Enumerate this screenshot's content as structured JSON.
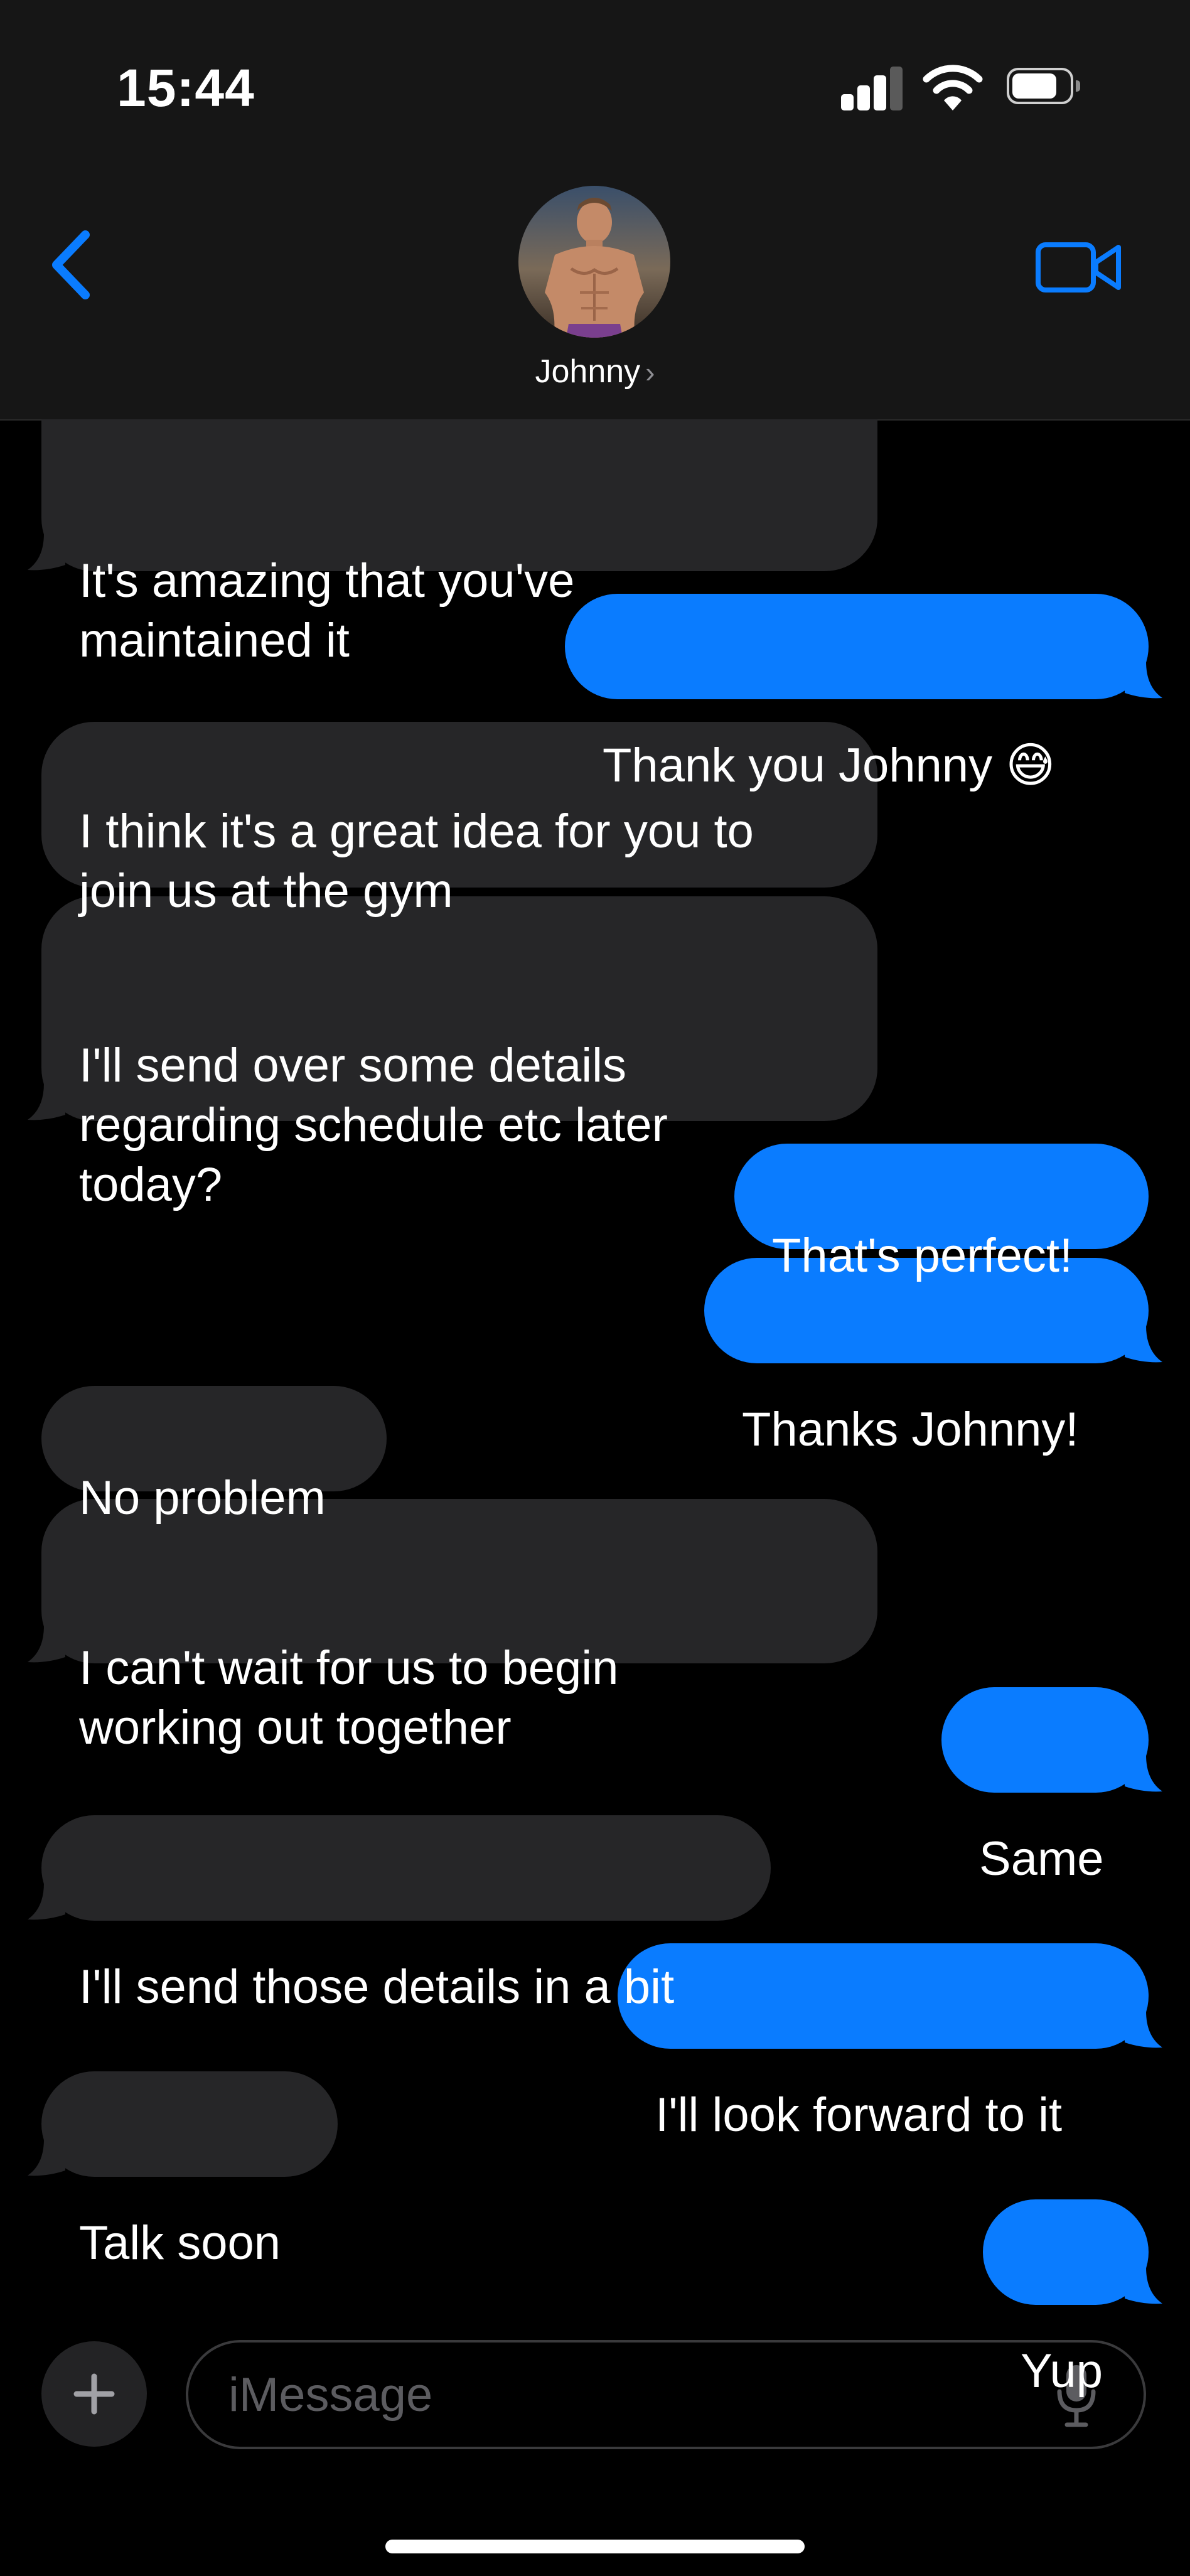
{
  "status_bar": {
    "time": "15:44"
  },
  "header": {
    "contact_name": "Johnny",
    "name_chevron": "›",
    "back_icon": "chevron-left-icon",
    "video_icon": "video-camera-icon"
  },
  "colors": {
    "accent": "#0a7cff",
    "incoming_bubble": "#262628",
    "background": "#000000"
  },
  "messages": [
    {
      "from": "them",
      "text": "It's amazing that you've\nmaintained it"
    },
    {
      "from": "me",
      "text": "Thank you Johnny 😅"
    },
    {
      "from": "them",
      "text": "I think it's a great idea for you to\njoin us at the gym"
    },
    {
      "from": "them",
      "text": "I'll send over some details\nregarding schedule etc later\ntoday?"
    },
    {
      "from": "me",
      "text": "That's perfect!"
    },
    {
      "from": "me",
      "text": "Thanks Johnny!"
    },
    {
      "from": "them",
      "text": "No problem"
    },
    {
      "from": "them",
      "text": "I can't wait for us to begin\nworking out together"
    },
    {
      "from": "me",
      "text": "Same"
    },
    {
      "from": "them",
      "text": "I'll send those details in a bit"
    },
    {
      "from": "me",
      "text": "I'll look forward to it"
    },
    {
      "from": "them",
      "text": "Talk soon"
    },
    {
      "from": "me",
      "text": "Yup"
    }
  ],
  "composer": {
    "placeholder": "iMessage",
    "plus_icon": "plus-icon",
    "mic_icon": "microphone-icon"
  }
}
